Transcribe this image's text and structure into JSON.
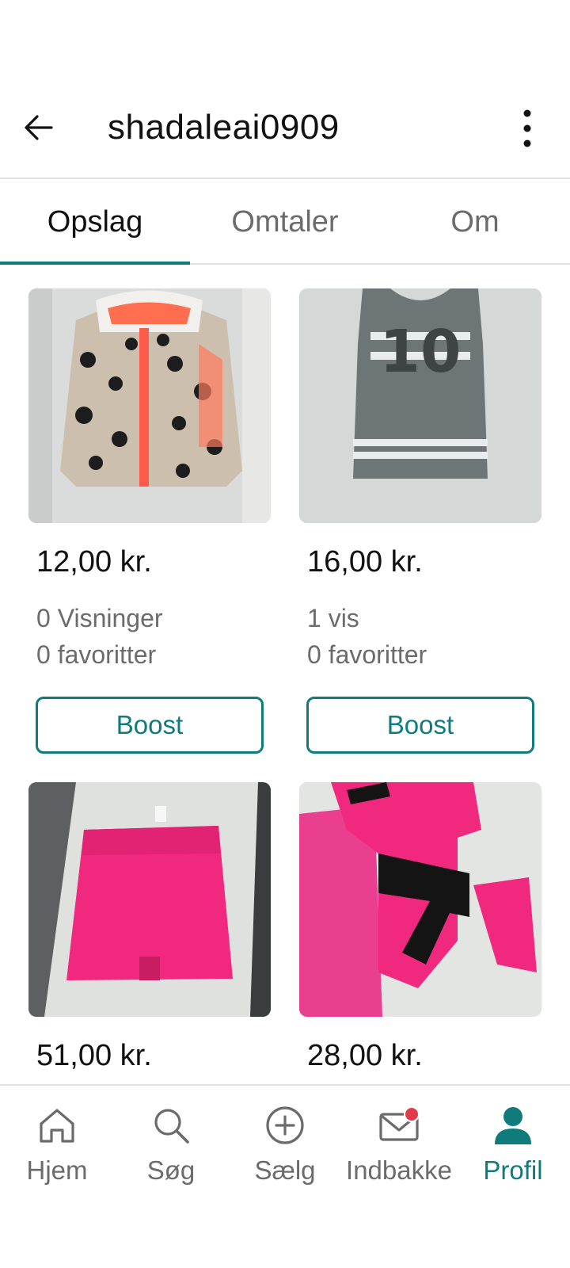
{
  "header": {
    "title": "shadaleai0909",
    "back_icon": "arrow-left-icon",
    "more_icon": "more-vertical-icon"
  },
  "tabs": [
    {
      "label": "Opslag",
      "active": true
    },
    {
      "label": "Omtaler",
      "active": false
    },
    {
      "label": "Om",
      "active": false
    }
  ],
  "listings": [
    {
      "price": "12,00 kr.",
      "views": "0 Visninger",
      "favorites": "0 favoritter",
      "boost_label": "Boost",
      "image": "leopard-print-hooded-vest"
    },
    {
      "price": "16,00 kr.",
      "views": "1 vis",
      "favorites": "0 favoritter",
      "boost_label": "Boost",
      "image": "grey-number-10-tank-top"
    },
    {
      "price": "51,00 kr.",
      "image": "pink-skirt"
    },
    {
      "price": "28,00 kr.",
      "image": "pink-black-long-sleeve-top"
    }
  ],
  "bottom_nav": [
    {
      "label": "Hjem",
      "icon": "home-icon",
      "active": false
    },
    {
      "label": "Søg",
      "icon": "search-icon",
      "active": false
    },
    {
      "label": "Sælg",
      "icon": "plus-circle-icon",
      "active": false
    },
    {
      "label": "Indbakke",
      "icon": "mail-icon",
      "active": false,
      "badge": true
    },
    {
      "label": "Profil",
      "icon": "profile-icon",
      "active": true
    }
  ],
  "colors": {
    "accent": "#0f7b7a",
    "badge": "#e23b4a",
    "muted_text": "#6b6b6b"
  }
}
